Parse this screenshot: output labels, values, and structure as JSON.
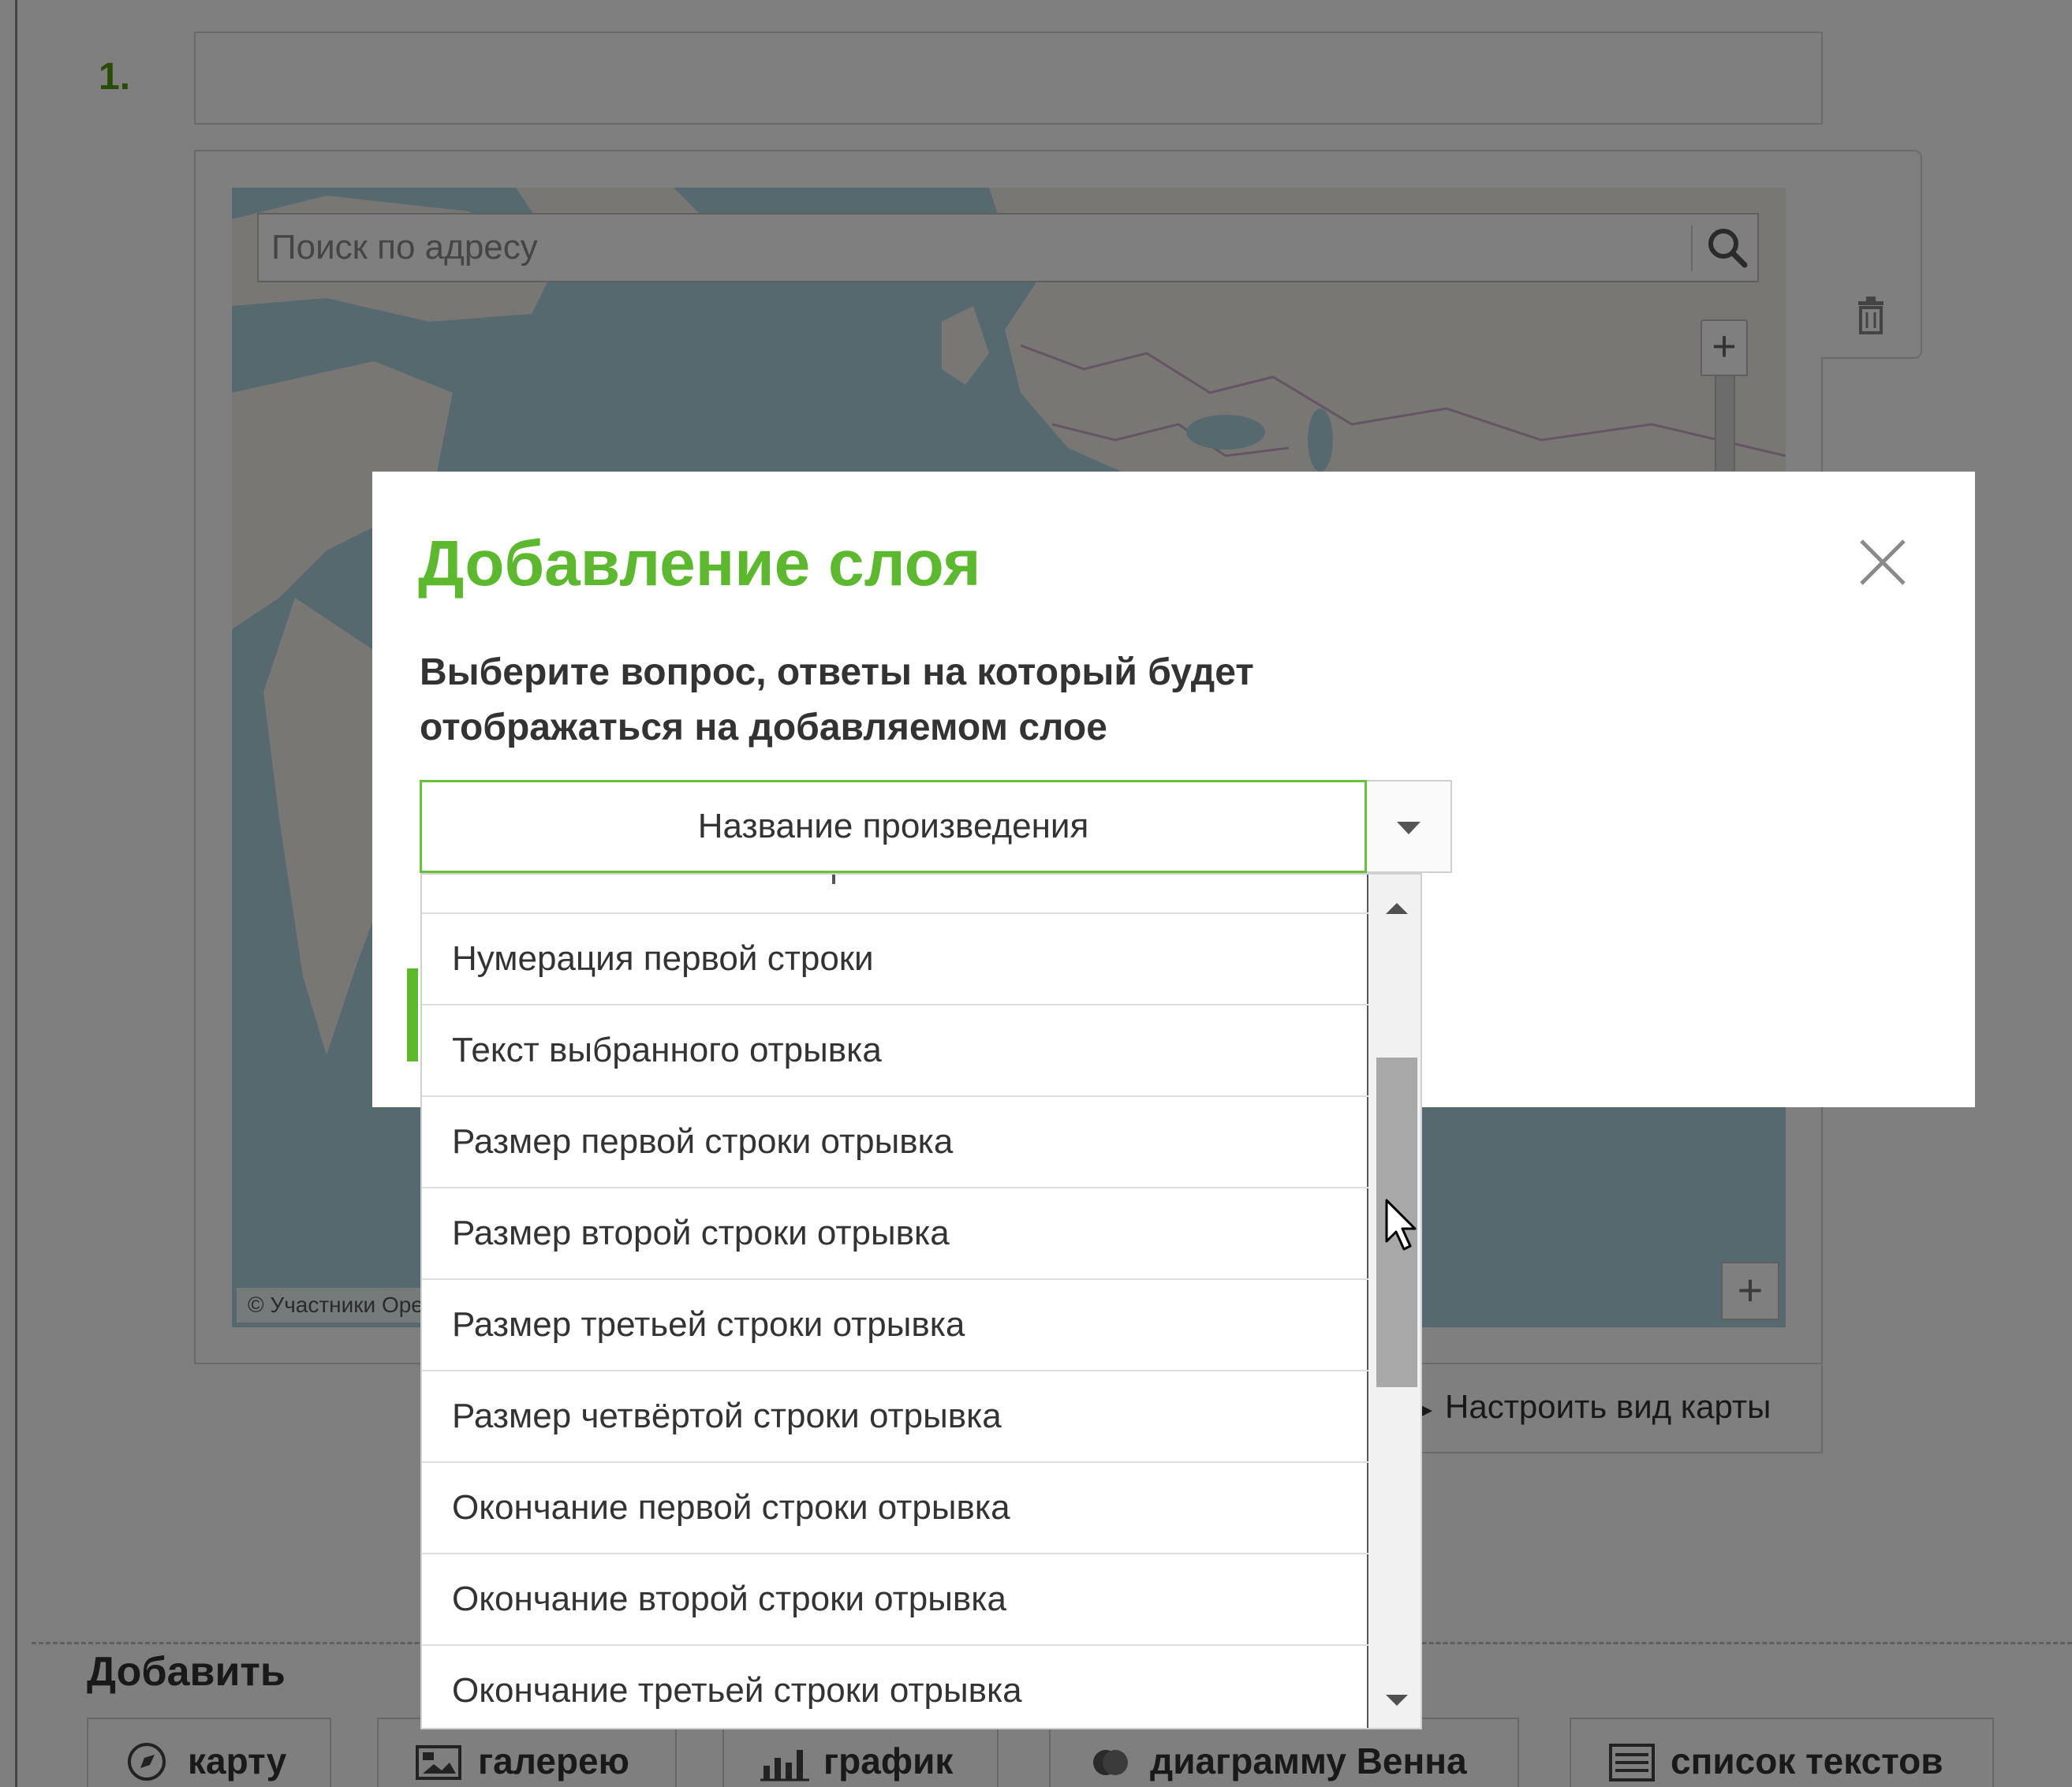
{
  "question": {
    "number": "1.",
    "title_value": ""
  },
  "map": {
    "search_placeholder": "Поиск по адресу",
    "zoom_in": "+",
    "attribution": "© Участники OpenStreetMap",
    "add_button": "+",
    "settings_link": "Настроить вид карты",
    "settings_icon": "chevron-right-icon"
  },
  "add_section": {
    "heading": "Добавить",
    "buttons": [
      {
        "label": "карту",
        "icon": "compass-icon"
      },
      {
        "label": "галерею",
        "icon": "gallery-icon"
      },
      {
        "label": "график",
        "icon": "bar-chart-icon"
      },
      {
        "label": "диаграмму Венна",
        "icon": "venn-icon"
      },
      {
        "label": "список текстов",
        "icon": "text-list-icon"
      }
    ]
  },
  "modal": {
    "title": "Добавление слоя",
    "prompt": "Выберите вопрос, ответы на который будет отображаться на добавляемом слое",
    "select_value": "Название произведения",
    "options": [
      "Нумерация первой строки",
      "Текст выбранного отрывка",
      "Размер первой строки отрывка",
      "Размер второй строки отрывка",
      "Размер третьей строки отрывка",
      "Размер четвёртой строки отрывка",
      "Окончание первой строки отрывка",
      "Окончание второй строки отрывка",
      "Окончание третьей строки отрывка"
    ],
    "accent_color": "#5cb82d"
  }
}
